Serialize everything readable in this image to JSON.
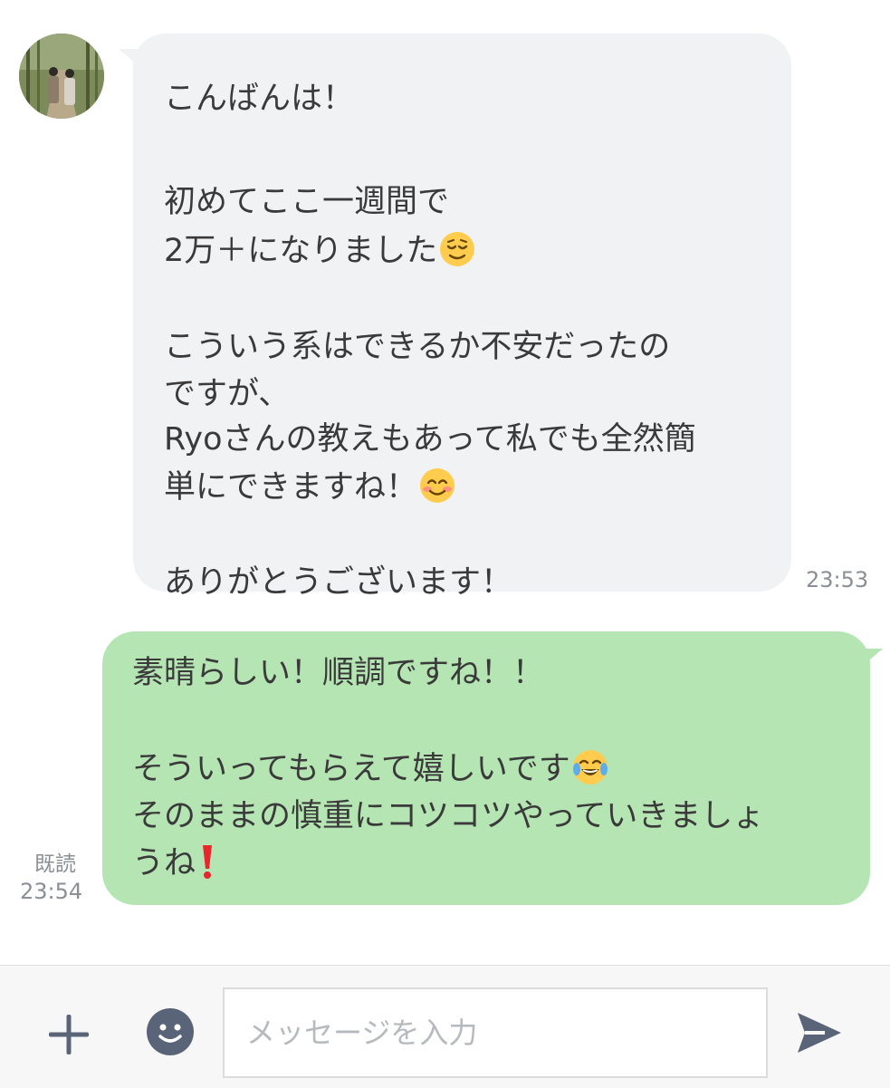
{
  "incoming_message": {
    "lines": [
      "こんばんは！",
      "初めてここ一週間で",
      "2万＋になりました",
      "こういう系はできるか不安だったの",
      "ですが、",
      "Ryoさんの教えもあって私でも全然簡",
      "単にできますね！",
      "ありがとうございます！"
    ],
    "emojis": [
      "relieved-face",
      "smiling-face-with-blush"
    ],
    "time": "23:53"
  },
  "outgoing_message": {
    "lines": [
      "素晴らしい！順調ですね！！",
      "そういってもらえて嬉しいです",
      "そのままの慎重にコツコツやっていきましょ",
      "うね"
    ],
    "emojis": [
      "face-with-tears-of-joy",
      "red-exclamation-mark"
    ],
    "read_status": "既読",
    "time": "23:54"
  },
  "composer": {
    "placeholder": "メッセージを入力",
    "value": "",
    "icons": [
      "plus-icon",
      "emoji-icon",
      "send-icon"
    ]
  },
  "colors": {
    "incoming_bubble": "#f1f2f4",
    "outgoing_bubble": "#b5e5b3",
    "icon": "#5a6478",
    "meta_text": "#8a8f95"
  }
}
